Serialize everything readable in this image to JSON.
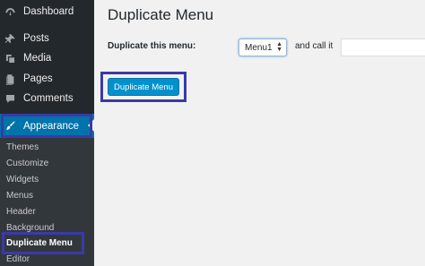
{
  "sidebar": {
    "menu": [
      {
        "label": "Dashboard",
        "icon": "dashboard-icon"
      },
      {
        "label": "Posts",
        "icon": "pin-icon"
      },
      {
        "label": "Media",
        "icon": "media-icon"
      },
      {
        "label": "Pages",
        "icon": "pages-icon"
      },
      {
        "label": "Comments",
        "icon": "comment-icon"
      }
    ],
    "appearance": {
      "label": "Appearance",
      "icon": "brush-icon"
    },
    "submenu": [
      "Themes",
      "Customize",
      "Widgets",
      "Menus",
      "Header",
      "Background",
      "Duplicate Menu",
      "Editor"
    ],
    "current_submenu": "Duplicate Menu"
  },
  "main": {
    "title": "Duplicate Menu",
    "duplicate_label": "Duplicate this menu:",
    "select_value": "Menu1",
    "call_label": "and call it",
    "name_value": "",
    "button_label": "Duplicate Menu"
  },
  "colors": {
    "sidebar_bg": "#23282d",
    "submenu_bg": "#32373c",
    "accent": "#0073aa",
    "button": "#0091cd",
    "highlight_outline": "#3b3aa6"
  }
}
